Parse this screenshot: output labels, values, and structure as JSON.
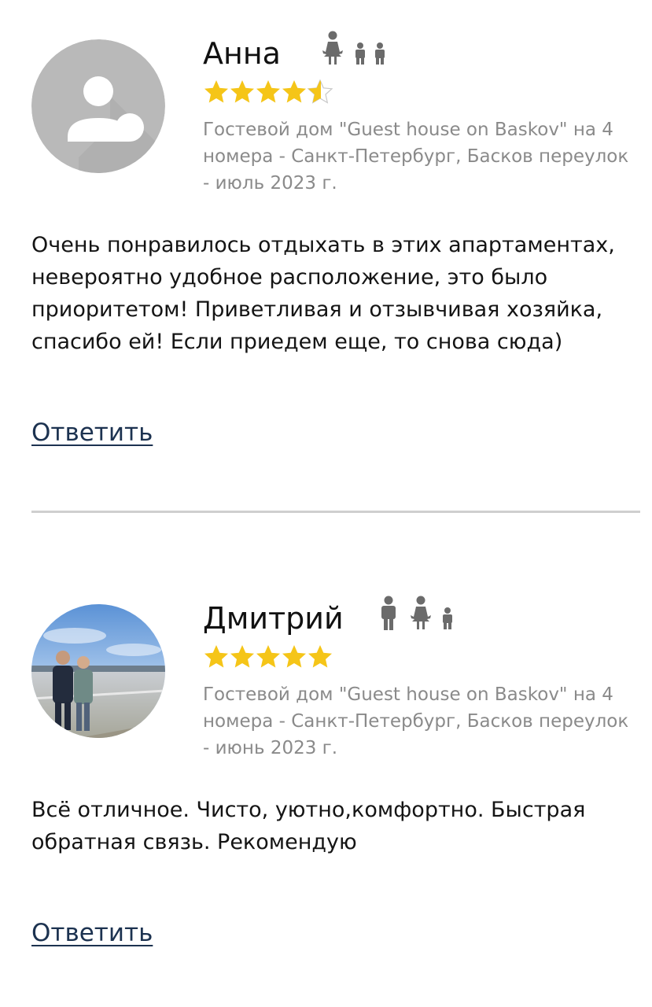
{
  "reviews": [
    {
      "name": "Анна",
      "rating": 4.5,
      "guests": [
        "female-adult-icon",
        "child-icon",
        "child-icon"
      ],
      "property": "Гостевой дом \"Guest house on Baskov\" на 4 номера - Санкт-Петербург, Басков переулок - июль 2023 г.",
      "text": "Очень понравилось отдыхать в этих апартаментах, невероятно удобное расположение, это было приоритетом! Приветливая и отзывчивая хозяйка, спасибо ей! Если приедем еще, то снова сюда)",
      "reply_label": "Ответить",
      "avatar": "default-user-avatar"
    },
    {
      "name": "Дмитрий",
      "rating": 5,
      "guests": [
        "male-adult-icon",
        "female-adult-icon",
        "child-icon"
      ],
      "property": "Гостевой дом \"Guest house on Baskov\" на 4 номера - Санкт-Петербург, Басков переулок - июнь 2023 г.",
      "text": "Всё отличное. Чисто, уютно,комфортно. Быстрая обратная связь. Рекомендую",
      "reply_label": "Ответить",
      "avatar": "user-photo"
    }
  ],
  "colors": {
    "star": "#f5c518",
    "star_empty_stroke": "#c8c8c8",
    "guest_icon": "#6b6b6b",
    "meta_text": "#8a8a8a",
    "link": "#1c3250",
    "divider": "#cfcfcf"
  }
}
